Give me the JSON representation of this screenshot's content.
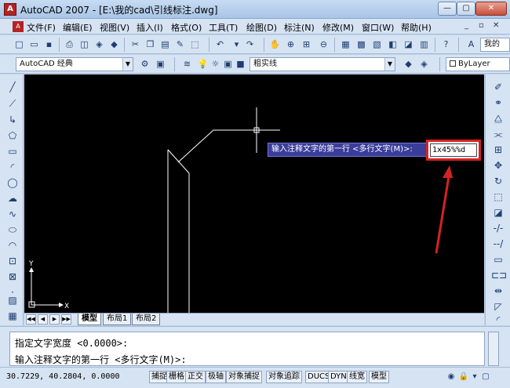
{
  "window": {
    "title": "AutoCAD 2007 - [E:\\我的cad\\引线标注.dwg]",
    "min": "—",
    "max": "▢",
    "close": "✕"
  },
  "menu": [
    "文件(F)",
    "编辑(E)",
    "视图(V)",
    "插入(I)",
    "格式(O)",
    "工具(T)",
    "绘图(D)",
    "标注(N)",
    "修改(M)",
    "窗口(W)",
    "帮助(H)"
  ],
  "toolbar2": {
    "workspace": "AutoCAD 经典",
    "layer": "粗实线",
    "bylayer": "ByLayer",
    "style_partial": "我的"
  },
  "canvas": {
    "tooltip": "输入注释文字的第一行 <多行文字(M)>:",
    "input_value": "1x45%%d",
    "ucs_x": "X",
    "ucs_y": "Y"
  },
  "tabs": [
    "模型",
    "布局1",
    "布局2"
  ],
  "command": {
    "line1": "指定文字宽度 <0.0000>:",
    "line2": "输入注释文字的第一行 <多行文字(M)>:"
  },
  "status": {
    "coords": "30.7229, 40.2804, 0.0000",
    "buttons": [
      "捕捉",
      "栅格",
      "正交",
      "极轴",
      "对象捕捉",
      "对象追踪",
      "DUCS",
      "DYN",
      "线宽",
      "模型"
    ]
  },
  "colors": {
    "canvas_bg": "#000000",
    "tooltip_bg": "#3a3d9a",
    "highlight": "#d42323",
    "geometry": "#ffffff"
  }
}
